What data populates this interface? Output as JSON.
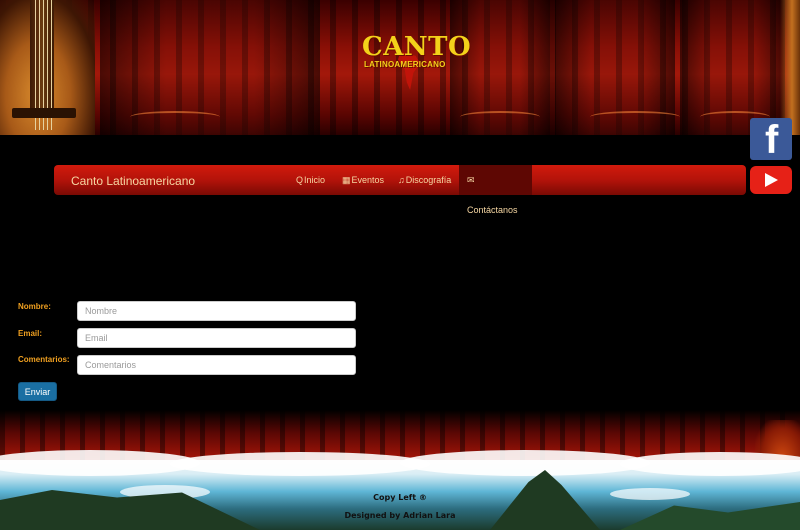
{
  "logo": {
    "title": "CANTO",
    "subtitle": "LATINOAMERICANO"
  },
  "social": {
    "facebook_glyph": "f"
  },
  "navbar": {
    "brand": "Canto Latinoamericano",
    "items": [
      {
        "label": "Inicio",
        "icon": "search-icon",
        "glyph": "Q"
      },
      {
        "label": "Eventos",
        "icon": "calendar-icon",
        "glyph": "▦"
      },
      {
        "label": "Discografía",
        "icon": "music-icon",
        "glyph": "♫"
      },
      {
        "label": "Contáctanos",
        "icon": "envelope-icon",
        "glyph": "✉"
      }
    ],
    "active": "Contáctanos"
  },
  "form": {
    "name_label": "Nombre:",
    "name_placeholder": "Nombre",
    "email_label": "Email:",
    "email_placeholder": "Email",
    "comments_label": "Comentarios:",
    "comments_placeholder": "Comentarios",
    "submit_label": "Enviar"
  },
  "footer": {
    "copyleft": "Copy Left ®",
    "designer": "Designed by Adrian Lara"
  },
  "colors": {
    "navbar": "#b3130a",
    "nav_active": "#5e0703",
    "label": "#f0a020",
    "button": "#1a6fa3",
    "facebook": "#3b5998",
    "youtube": "#e62117"
  }
}
